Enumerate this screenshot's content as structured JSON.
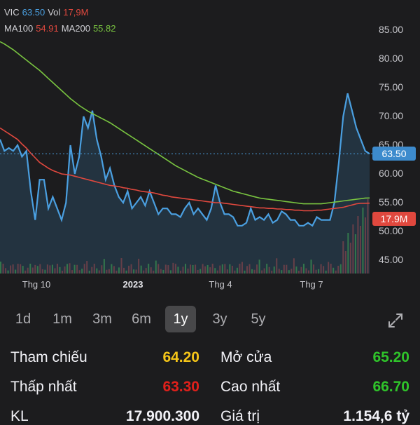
{
  "legend": {
    "symbol": "VIC",
    "price": "63.50",
    "vol_label": "Vol",
    "vol": "17,9M",
    "ma100_label": "MA100",
    "ma100": "54.91",
    "ma200_label": "MA200",
    "ma200": "55.82"
  },
  "colors": {
    "price": "#4a9fe0",
    "ma100": "#e0483e",
    "ma200": "#79c440",
    "yellow": "#f5c518",
    "red": "#e0201b",
    "green": "#2fc42a"
  },
  "chart_data": {
    "type": "line",
    "y_ticks": [
      "85.00",
      "80.00",
      "75.00",
      "70.00",
      "65.00",
      "60.00",
      "55.00",
      "50.00",
      "45.00"
    ],
    "x_ticks": [
      "Thg 10",
      "2023",
      "Thg 4",
      "Thg 7"
    ],
    "ylim": [
      42,
      87
    ],
    "last_price_label": "63.50",
    "volume_label": "17.9M",
    "series": [
      {
        "name": "VIC",
        "values": [
          66,
          64,
          64.5,
          64,
          65,
          63,
          64,
          57,
          52,
          59,
          59,
          54,
          56,
          54,
          52,
          55,
          65,
          60,
          63,
          70,
          68,
          71,
          66,
          63,
          59,
          61,
          58,
          56,
          55,
          57,
          54,
          55,
          56,
          54.5,
          57,
          55,
          53,
          54,
          54,
          53,
          53,
          52.5,
          54,
          55,
          53,
          54,
          53,
          52,
          54,
          58,
          55,
          53,
          53,
          52.5,
          51,
          51,
          51.5,
          54,
          52,
          52.5,
          52,
          53,
          51.5,
          52,
          53.5,
          53,
          52,
          52,
          51,
          51,
          51.5,
          51,
          52.5,
          52,
          52,
          52,
          55,
          62,
          70,
          74,
          71,
          68,
          66,
          64,
          63.5
        ]
      },
      {
        "name": "MA100",
        "values": [
          68,
          67.5,
          67,
          66.5,
          66,
          65.2,
          64.5,
          63.6,
          62.8,
          62,
          61.5,
          61,
          60.6,
          60.3,
          60,
          59.9,
          59.8,
          59.6,
          59.4,
          59.2,
          59,
          58.8,
          58.6,
          58.4,
          58.2,
          58,
          57.9,
          57.8,
          57.6,
          57.5,
          57.3,
          57.2,
          57,
          56.9,
          56.8,
          56.7,
          56.5,
          56.3,
          56.2,
          56,
          55.9,
          55.8,
          55.7,
          55.6,
          55.5,
          55.4,
          55.3,
          55.2,
          55.1,
          55,
          55,
          54.9,
          54.8,
          54.7,
          54.6,
          54.5,
          54.4,
          54.3,
          54.2,
          54.1,
          54.1,
          54,
          54,
          53.9,
          53.9,
          53.8,
          53.8,
          53.7,
          53.7,
          53.6,
          53.6,
          53.6,
          53.7,
          53.7,
          53.8,
          53.9,
          54,
          54.1,
          54.2,
          54.4,
          54.6,
          54.8,
          54.9,
          54.9,
          54.91
        ]
      },
      {
        "name": "MA200",
        "values": [
          83,
          82.6,
          82.1,
          81.6,
          81,
          80.4,
          79.8,
          79.2,
          78.6,
          78,
          77.3,
          76.6,
          75.9,
          75.2,
          74.5,
          73.8,
          73.1,
          72.5,
          71.9,
          71.4,
          70.9,
          70.5,
          70.1,
          69.7,
          69.3,
          68.9,
          68.4,
          67.9,
          67.4,
          66.9,
          66.4,
          65.9,
          65.4,
          64.9,
          64.4,
          63.9,
          63.4,
          62.9,
          62.4,
          61.9,
          61.4,
          61,
          60.6,
          60.2,
          59.8,
          59.4,
          59.1,
          58.8,
          58.5,
          58.2,
          57.9,
          57.6,
          57.3,
          57,
          56.8,
          56.6,
          56.4,
          56.2,
          56,
          55.8,
          55.7,
          55.6,
          55.5,
          55.4,
          55.3,
          55.2,
          55.1,
          55,
          54.9,
          54.8,
          54.8,
          54.8,
          54.8,
          54.8,
          54.9,
          55,
          55.1,
          55.2,
          55.3,
          55.4,
          55.5,
          55.6,
          55.7,
          55.8,
          55.82
        ]
      }
    ]
  },
  "ranges": [
    "1d",
    "1m",
    "3m",
    "6m",
    "1y",
    "3y",
    "5y"
  ],
  "active_range": "1y",
  "stats": {
    "ref_label": "Tham chiếu",
    "ref": "64.20",
    "open_label": "Mở cửa",
    "open": "65.20",
    "low_label": "Thấp nhất",
    "low": "63.30",
    "high_label": "Cao nhất",
    "high": "66.70",
    "kl_label": "KL",
    "kl": "17.900.300",
    "gt_label": "Giá trị",
    "gt": "1.154,6 tỷ"
  }
}
